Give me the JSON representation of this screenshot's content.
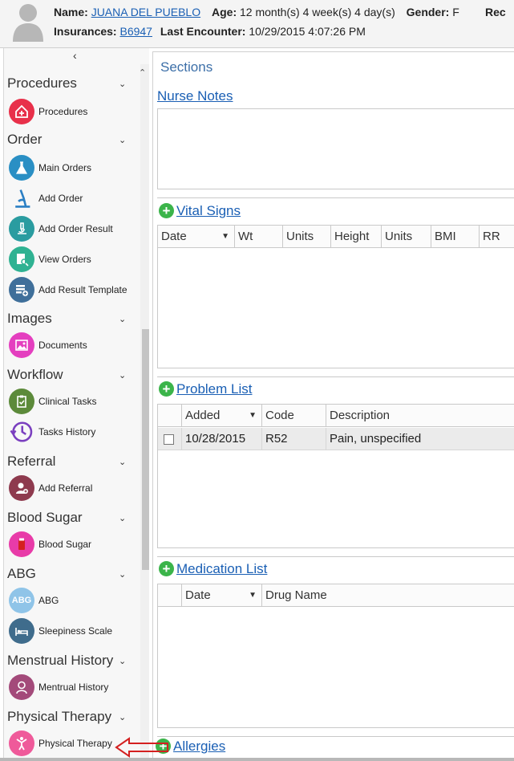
{
  "header": {
    "name_label": "Name:",
    "name_value": "JUANA DEL PUEBLO",
    "age_label": "Age:",
    "age_value": "12 month(s) 4 week(s) 4 day(s)",
    "gender_label": "Gender:",
    "gender_value": "F",
    "rec_truncated": "Rec",
    "insurances_label": "Insurances:",
    "insurances_value": "B6947",
    "last_encounter_label": "Last Encounter:",
    "last_encounter_value": "10/29/2015 4:07:26 PM"
  },
  "sidebar": {
    "collapse_glyph": "‹",
    "categories": {
      "procedures": "Procedures",
      "order": "Order",
      "images": "Images",
      "workflow": "Workflow",
      "referral": "Referral",
      "blood_sugar": "Blood Sugar",
      "abg": "ABG",
      "menstrual_history": "Menstrual History",
      "physical_therapy": "Physical Therapy"
    },
    "items": {
      "procedures": "Procedures",
      "main_orders": "Main Orders",
      "add_order": "Add Order",
      "add_order_result": "Add Order Result",
      "view_orders": "View Orders",
      "add_result_template": "Add Result Template",
      "documents": "Documents",
      "clinical_tasks": "Clinical Tasks",
      "tasks_history": "Tasks History",
      "add_referral": "Add Referral",
      "blood_sugar": "Blood Sugar",
      "abg": "ABG",
      "abg_icon_text": "ABG",
      "sleepiness_scale": "Sleepiness Scale",
      "mentrual_history": "Mentrual History",
      "physical_therapy": "Physical Therapy"
    }
  },
  "main": {
    "sections_title": "Sections",
    "nurse_notes": "Nurse Notes",
    "vital_signs": {
      "title": "Vital Signs",
      "columns": [
        "Date",
        "Wt",
        "Units",
        "Height",
        "Units",
        "BMI",
        "RR"
      ]
    },
    "problem_list": {
      "title": "Problem List",
      "columns": [
        "Added",
        "Code",
        "Description"
      ],
      "rows": [
        {
          "added": "10/28/2015",
          "code": "R52",
          "description": "Pain, unspecified"
        }
      ]
    },
    "medication_list": {
      "title": "Medication List",
      "columns": [
        "Date",
        "Drug Name"
      ]
    },
    "allergies": "Allergies"
  },
  "colors": {
    "link": "#1a5fb4",
    "add_green": "#3bb44a",
    "arrow_red": "#d42020"
  }
}
